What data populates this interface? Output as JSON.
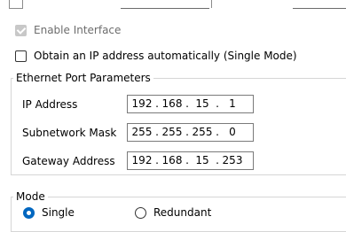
{
  "enable_interface": {
    "label": "Enable Interface",
    "checked": true,
    "disabled": true
  },
  "obtain_ip": {
    "label": "Obtain an IP address automatically (Single Mode)",
    "checked": false
  },
  "ethernet_group": {
    "title": "Ethernet Port Parameters",
    "ip_address": {
      "label": "IP Address",
      "octets": [
        "192",
        "168",
        "15",
        "1"
      ]
    },
    "subnet_mask": {
      "label": "Subnetwork Mask",
      "octets": [
        "255",
        "255",
        "255",
        "0"
      ]
    },
    "gateway": {
      "label": "Gateway Address",
      "octets": [
        "192",
        "168",
        "15",
        "253"
      ]
    },
    "separator": "."
  },
  "mode_group": {
    "title": "Mode",
    "options": [
      {
        "label": "Single",
        "selected": true
      },
      {
        "label": "Redundant",
        "selected": false
      }
    ]
  },
  "colors": {
    "accent": "#0067c0",
    "disabled_text": "#6d6d6d",
    "border": "#d6d6d6"
  }
}
